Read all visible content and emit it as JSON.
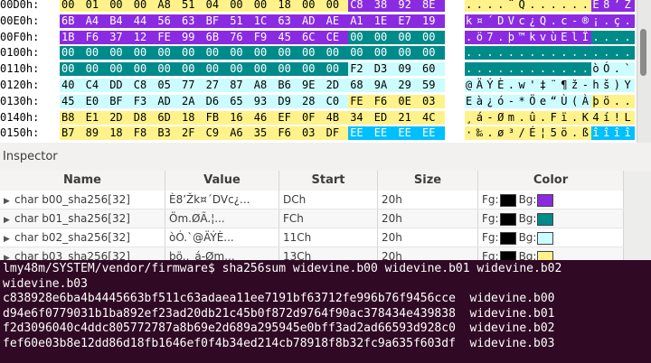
{
  "hex": {
    "rows": [
      {
        "offset": "00D0h:",
        "bytes": [
          "00",
          "01",
          "00",
          "00",
          "A8",
          "51",
          "04",
          "00",
          "00",
          "18",
          "00",
          "00",
          "C8",
          "38",
          "92",
          "8E"
        ],
        "ascii": "....¨Q......È8’Ž",
        "colors": [
          "#fff28a",
          "#fff28a",
          "#fff28a",
          "#fff28a",
          "#fff28a",
          "#fff28a",
          "#fff28a",
          "#fff28a",
          "#fff28a",
          "#fff28a",
          "#fff28a",
          "#fff28a",
          "#8a2be2",
          "#8a2be2",
          "#8a2be2",
          "#8a2be2"
        ]
      },
      {
        "offset": "00E0h:",
        "bytes": [
          "6B",
          "A4",
          "B4",
          "44",
          "56",
          "63",
          "BF",
          "51",
          "1C",
          "63",
          "AD",
          "AE",
          "A1",
          "1E",
          "E7",
          "19"
        ],
        "ascii": "k¤´DVc¿Q.c-®¡.ç.",
        "colors": [
          "#8a2be2",
          "#8a2be2",
          "#8a2be2",
          "#8a2be2",
          "#8a2be2",
          "#8a2be2",
          "#8a2be2",
          "#8a2be2",
          "#8a2be2",
          "#8a2be2",
          "#8a2be2",
          "#8a2be2",
          "#8a2be2",
          "#8a2be2",
          "#8a2be2",
          "#8a2be2"
        ]
      },
      {
        "offset": "00F0h:",
        "bytes": [
          "1B",
          "F6",
          "37",
          "12",
          "FE",
          "99",
          "6B",
          "76",
          "F9",
          "45",
          "6C",
          "CE",
          "00",
          "00",
          "00",
          "00"
        ],
        "ascii": ".ö7.þ™kvùElÎ....",
        "colors": [
          "#8a2be2",
          "#8a2be2",
          "#8a2be2",
          "#8a2be2",
          "#8a2be2",
          "#8a2be2",
          "#8a2be2",
          "#8a2be2",
          "#8a2be2",
          "#8a2be2",
          "#8a2be2",
          "#8a2be2",
          "#008b8b",
          "#008b8b",
          "#008b8b",
          "#008b8b"
        ]
      },
      {
        "offset": "0100h:",
        "bytes": [
          "00",
          "00",
          "00",
          "00",
          "00",
          "00",
          "00",
          "00",
          "00",
          "00",
          "00",
          "00",
          "00",
          "00",
          "00",
          "00"
        ],
        "ascii": "................",
        "colors": [
          "#008b8b",
          "#008b8b",
          "#008b8b",
          "#008b8b",
          "#008b8b",
          "#008b8b",
          "#008b8b",
          "#008b8b",
          "#008b8b",
          "#008b8b",
          "#008b8b",
          "#008b8b",
          "#008b8b",
          "#008b8b",
          "#008b8b",
          "#008b8b"
        ]
      },
      {
        "offset": "0110h:",
        "bytes": [
          "00",
          "00",
          "00",
          "00",
          "00",
          "00",
          "00",
          "00",
          "00",
          "00",
          "00",
          "00",
          "F2",
          "D3",
          "09",
          "60"
        ],
        "ascii": "............òÓ.`",
        "colors": [
          "#008b8b",
          "#008b8b",
          "#008b8b",
          "#008b8b",
          "#008b8b",
          "#008b8b",
          "#008b8b",
          "#008b8b",
          "#008b8b",
          "#008b8b",
          "#008b8b",
          "#008b8b",
          "#ccfcff",
          "#ccfcff",
          "#ccfcff",
          "#ccfcff"
        ]
      },
      {
        "offset": "0120h:",
        "bytes": [
          "40",
          "C4",
          "DD",
          "C8",
          "05",
          "77",
          "27",
          "87",
          "A8",
          "B6",
          "9E",
          "2D",
          "68",
          "9A",
          "29",
          "59"
        ],
        "ascii": "@ÄÝÈ.w'‡¨¶ž-hš)Y",
        "colors": [
          "#ccfcff",
          "#ccfcff",
          "#ccfcff",
          "#ccfcff",
          "#ccfcff",
          "#ccfcff",
          "#ccfcff",
          "#ccfcff",
          "#ccfcff",
          "#ccfcff",
          "#ccfcff",
          "#ccfcff",
          "#ccfcff",
          "#ccfcff",
          "#ccfcff",
          "#ccfcff"
        ]
      },
      {
        "offset": "0130h:",
        "bytes": [
          "45",
          "E0",
          "BF",
          "F3",
          "AD",
          "2A",
          "D6",
          "65",
          "93",
          "D9",
          "28",
          "C0",
          "FE",
          "F6",
          "0E",
          "03"
        ],
        "ascii": "Eà¿ó-*Öe“Ù(Àþö..",
        "colors": [
          "#ccfcff",
          "#ccfcff",
          "#ccfcff",
          "#ccfcff",
          "#ccfcff",
          "#ccfcff",
          "#ccfcff",
          "#ccfcff",
          "#ccfcff",
          "#ccfcff",
          "#ccfcff",
          "#ccfcff",
          "#fff28a",
          "#fff28a",
          "#fff28a",
          "#fff28a"
        ]
      },
      {
        "offset": "0140h:",
        "bytes": [
          "B8",
          "E1",
          "2D",
          "D8",
          "6D",
          "18",
          "FB",
          "16",
          "46",
          "EF",
          "0F",
          "4B",
          "34",
          "ED",
          "21",
          "4C"
        ],
        "ascii": "¸á-Øm.û.Fï.K4í!L",
        "colors": [
          "#fff28a",
          "#fff28a",
          "#fff28a",
          "#fff28a",
          "#fff28a",
          "#fff28a",
          "#fff28a",
          "#fff28a",
          "#fff28a",
          "#fff28a",
          "#fff28a",
          "#fff28a",
          "#fff28a",
          "#fff28a",
          "#fff28a",
          "#fff28a"
        ]
      },
      {
        "offset": "0150h:",
        "bytes": [
          "B7",
          "89",
          "18",
          "F8",
          "B3",
          "2F",
          "C9",
          "A6",
          "35",
          "F6",
          "03",
          "DF",
          "EE",
          "EE",
          "EE",
          "EE"
        ],
        "ascii": "·‰.ø³/É¦5ö.ßîîîî",
        "colors": [
          "#fff28a",
          "#fff28a",
          "#fff28a",
          "#fff28a",
          "#fff28a",
          "#fff28a",
          "#fff28a",
          "#fff28a",
          "#fff28a",
          "#fff28a",
          "#fff28a",
          "#fff28a",
          "#00bfff",
          "#00bfff",
          "#00bfff",
          "#00bfff"
        ]
      }
    ]
  },
  "inspector": {
    "title": "Inspector",
    "columns": {
      "name": "Name",
      "value": "Value",
      "start": "Start",
      "size": "Size",
      "color": "Color"
    },
    "rows": [
      {
        "name": "char b00_sha256[32]",
        "value": "È8’Žk¤´DVc¿...",
        "start": "DCh",
        "size": "20h",
        "fg_label": "Fg:",
        "bg_label": "Bg:",
        "fg": "#000000",
        "bg": "#8a2be2"
      },
      {
        "name": "char b01_sha256[32]",
        "value": "Öm.ØÃ.¦...",
        "start": "FCh",
        "size": "20h",
        "fg_label": "Fg:",
        "bg_label": "Bg:",
        "fg": "#000000",
        "bg": "#008b8b"
      },
      {
        "name": "char b02_sha256[32]",
        "value": "òÓ.`@ÄÝÈ...",
        "start": "11Ch",
        "size": "20h",
        "fg_label": "Fg:",
        "bg_label": "Bg:",
        "fg": "#000000",
        "bg": "#ccfcff"
      },
      {
        "name": "char b03_sha256[32]",
        "value": "þö..¸á-Øm...",
        "start": "13Ch",
        "size": "20h",
        "fg_label": "Fg:",
        "bg_label": "Bg:",
        "fg": "#000000",
        "bg": "#fff28a"
      }
    ]
  },
  "terminal": {
    "lines": [
      "lmy48m/SYSTEM/vendor/firmware$ sha256sum widevine.b00 widevine.b01 widevine.b02",
      "widevine.b03",
      "c838928e6ba4b4445663bf511c63adaea11ee7191bf63712fe996b76f9456cce  widevine.b00",
      "d94e6f0779031b1ba892ef23ad20db21c45b0f872d9764f90ac378434e439838  widevine.b01",
      "f2d3096040c4ddc805772787a8b69e2d689a295945e0bff3ad2ad66593d928c0  widevine.b02",
      "fef60e03b8e12dd86d18fb1646ef0f4b34ed214cb78918f8b32fc9a635f603df  widevine.b03"
    ]
  }
}
